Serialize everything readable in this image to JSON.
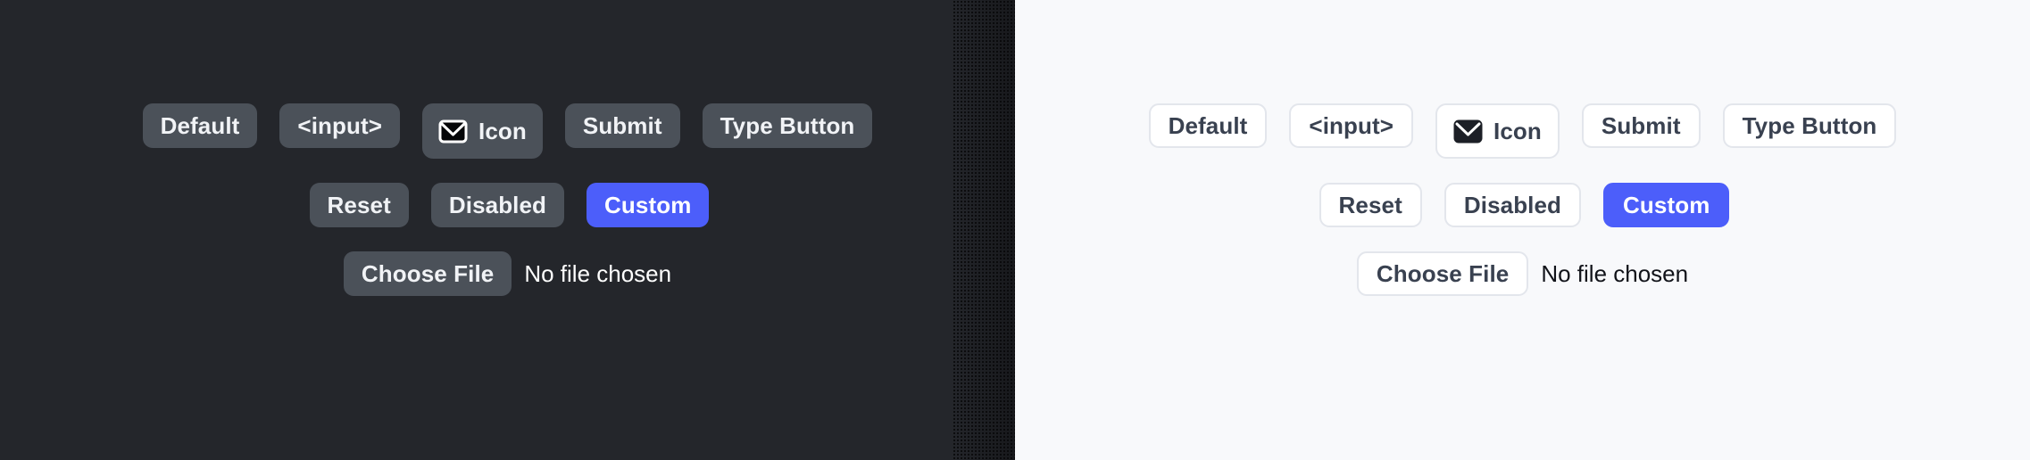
{
  "theme": {
    "dark_background": "#24262b",
    "light_background": "#f8f9fb",
    "dark_button_background": "#4b5159",
    "dark_button_text": "#f1f3f6",
    "light_button_background": "#ffffff",
    "light_button_border": "#e3e6ec",
    "light_button_text": "#394150",
    "accent": "#4c5efa"
  },
  "panes": [
    {
      "name": "dark-theme-pane",
      "mode": "dark",
      "rows": [
        {
          "name": "row-primary",
          "buttons": [
            {
              "label": "Default",
              "variant": "default",
              "icon": null
            },
            {
              "label": "<input>",
              "variant": "default",
              "icon": null
            },
            {
              "label": "Icon",
              "variant": "icon",
              "icon": "envelope-icon"
            },
            {
              "label": "Submit",
              "variant": "default",
              "icon": null
            },
            {
              "label": "Type Button",
              "variant": "default",
              "icon": null
            }
          ]
        },
        {
          "name": "row-secondary",
          "buttons": [
            {
              "label": "Reset",
              "variant": "default",
              "icon": null
            },
            {
              "label": "Disabled",
              "variant": "disabled",
              "icon": null
            },
            {
              "label": "Custom",
              "variant": "accent",
              "icon": null
            }
          ]
        }
      ],
      "file_input": {
        "button_label": "Choose File",
        "status_text": "No file chosen"
      }
    },
    {
      "name": "light-theme-pane",
      "mode": "light",
      "rows": [
        {
          "name": "row-primary",
          "buttons": [
            {
              "label": "Default",
              "variant": "default",
              "icon": null
            },
            {
              "label": "<input>",
              "variant": "default",
              "icon": null
            },
            {
              "label": "Icon",
              "variant": "icon",
              "icon": "envelope-icon"
            },
            {
              "label": "Submit",
              "variant": "default",
              "icon": null
            },
            {
              "label": "Type Button",
              "variant": "default",
              "icon": null
            }
          ]
        },
        {
          "name": "row-secondary",
          "buttons": [
            {
              "label": "Reset",
              "variant": "default",
              "icon": null
            },
            {
              "label": "Disabled",
              "variant": "disabled",
              "icon": null
            },
            {
              "label": "Custom",
              "variant": "accent",
              "icon": null
            }
          ]
        }
      ],
      "file_input": {
        "button_label": "Choose File",
        "status_text": "No file chosen"
      }
    }
  ]
}
